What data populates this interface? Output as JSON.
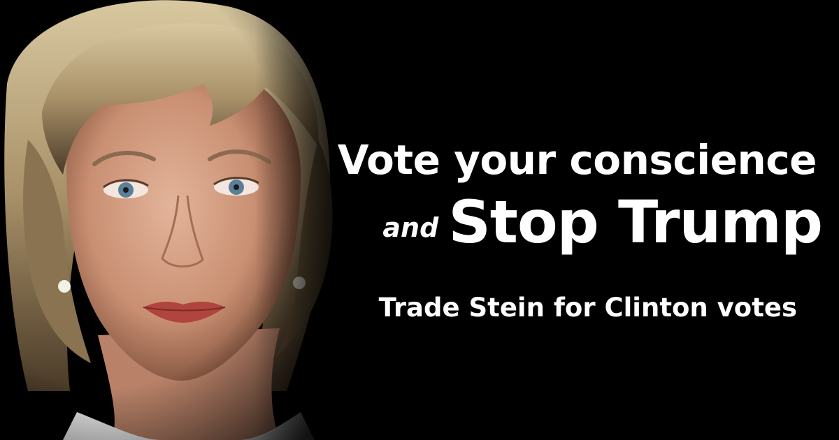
{
  "colors": {
    "background": "#000000",
    "text": "#ffffff"
  },
  "headline": {
    "line1": "Vote your conscience",
    "connector": "and",
    "line2": "Stop Trump",
    "line3": "Trade Stein for Clinton votes"
  }
}
